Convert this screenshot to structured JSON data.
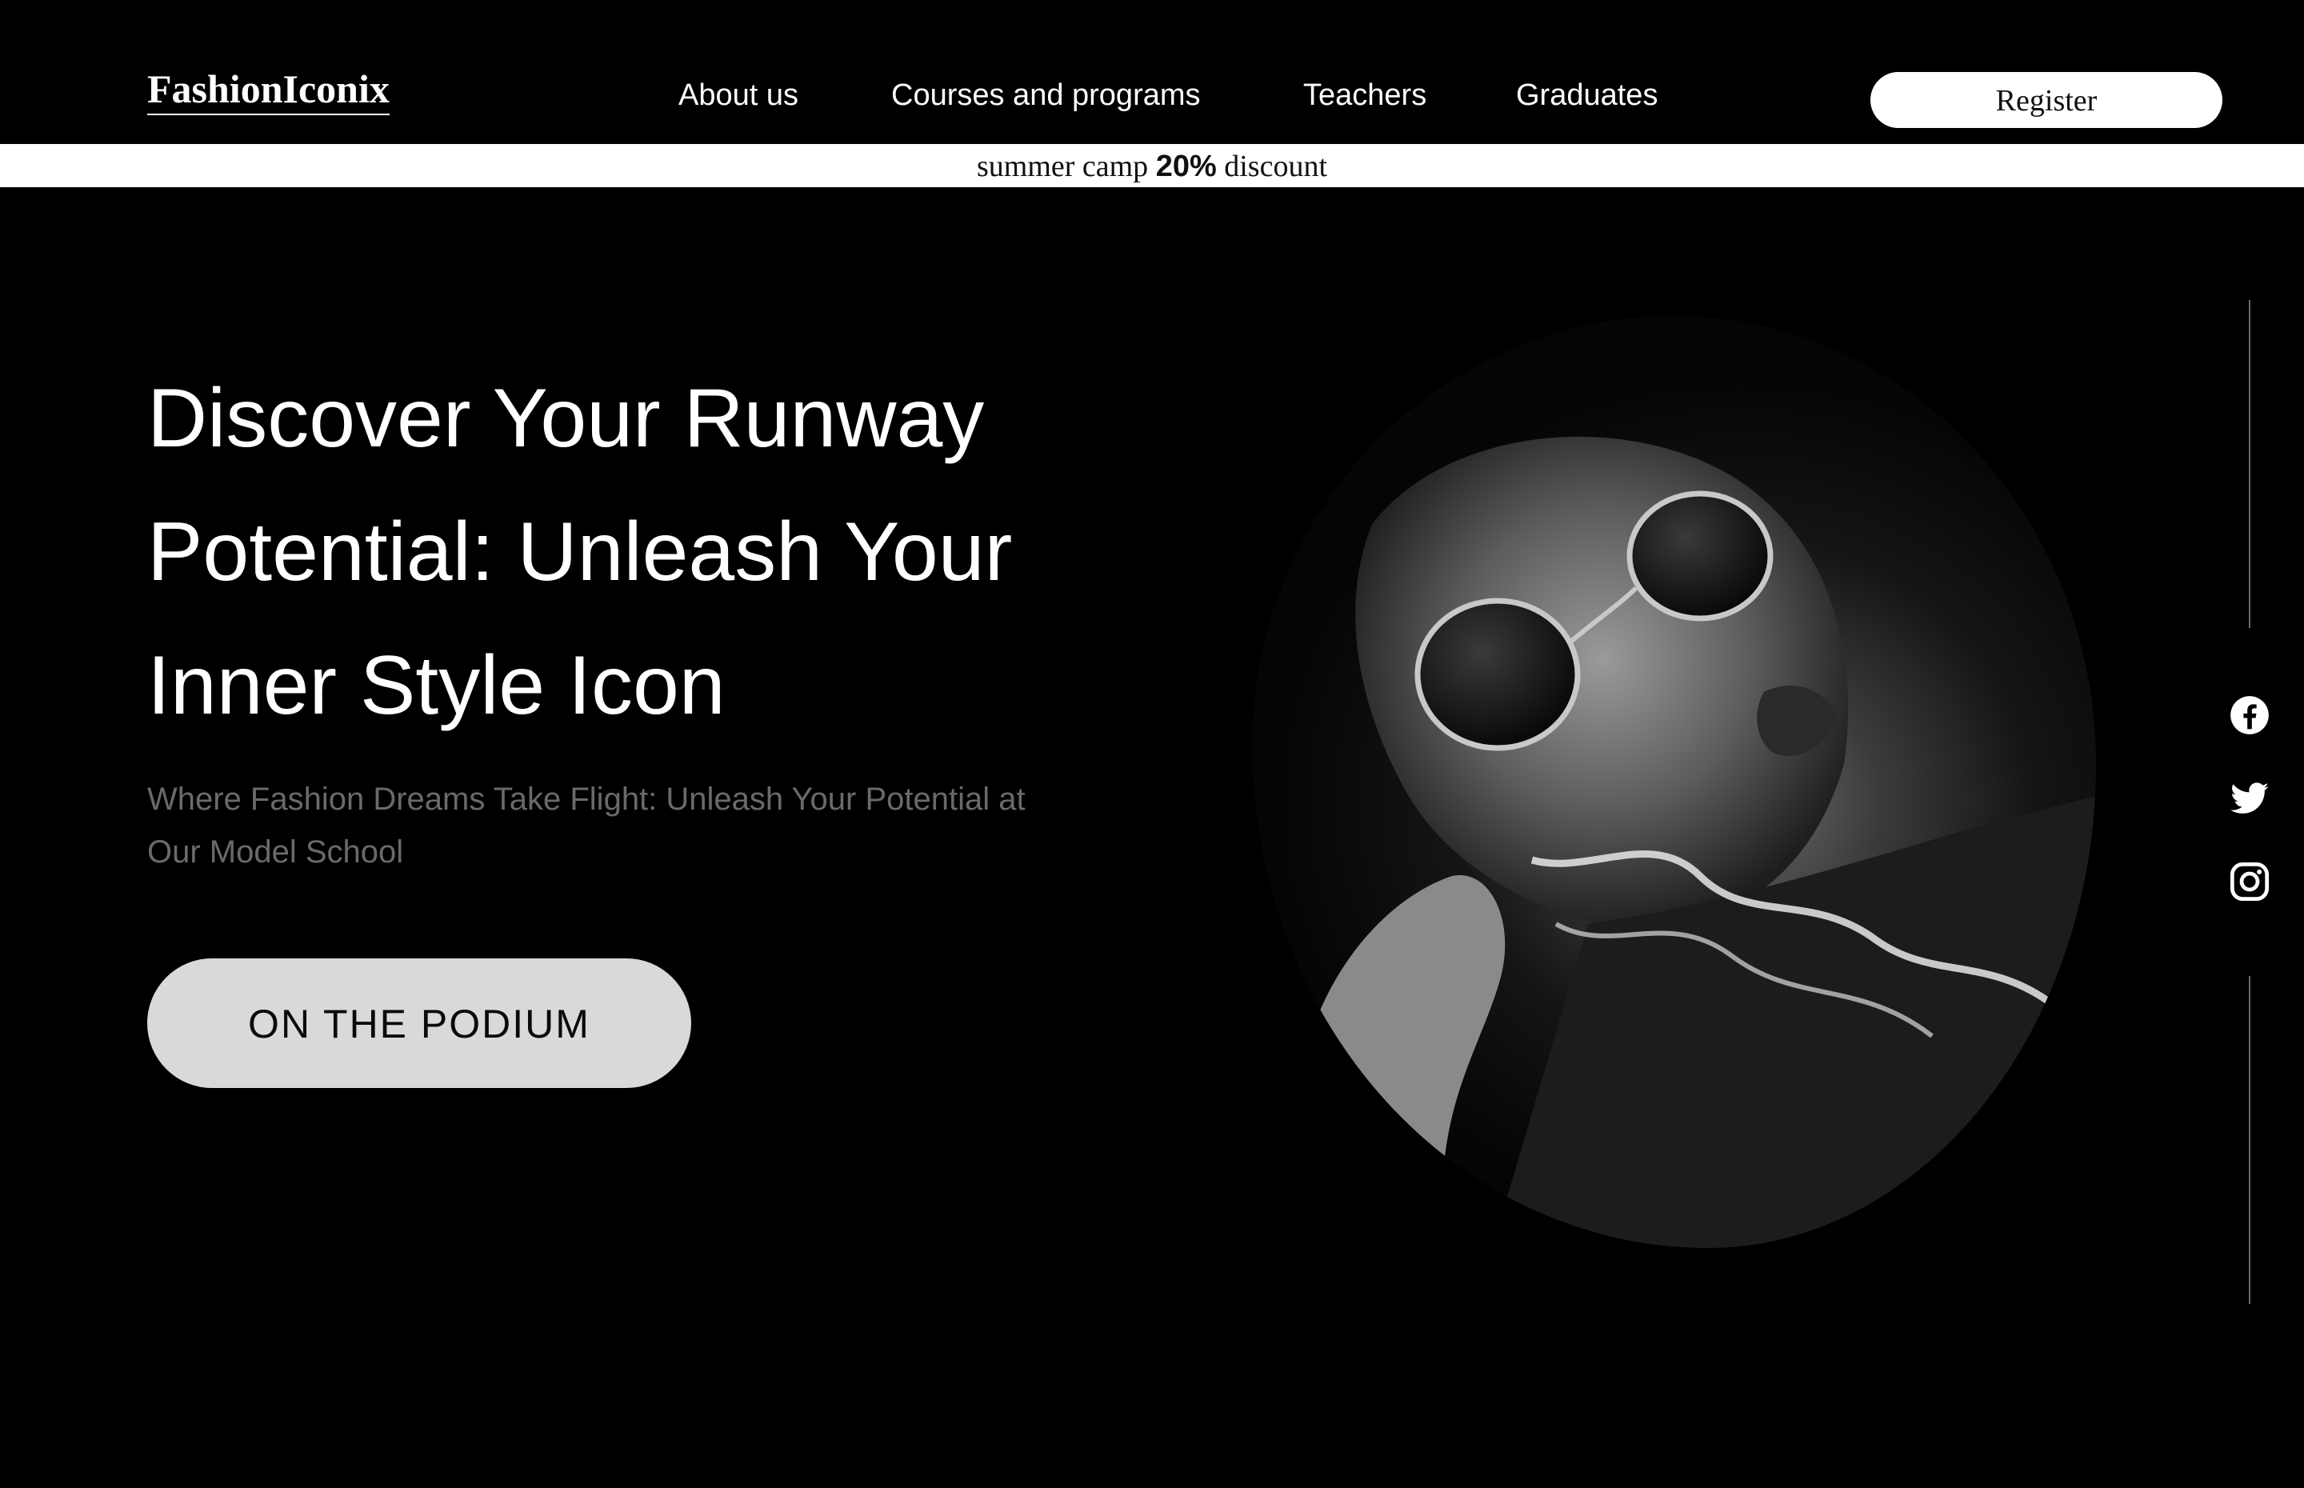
{
  "header": {
    "logo": "FashionIconix",
    "nav": [
      {
        "label": "About us"
      },
      {
        "label": "Courses and programs"
      },
      {
        "label": "Teachers"
      },
      {
        "label": "Graduates"
      }
    ],
    "register_label": "Register"
  },
  "promo": {
    "prefix": "summer camp",
    "highlight": "20%",
    "suffix": "discount"
  },
  "hero": {
    "title_lines": [
      "Discover Your Runway",
      "Potential: Unleash Your",
      "Inner Style Icon"
    ],
    "subtitle": "Where Fashion Dreams Take Flight: Unleash Your Potential at Our Model School",
    "cta_label": "ON THE PODIUM"
  },
  "social": {
    "icons": [
      "facebook-icon",
      "twitter-icon",
      "instagram-icon"
    ]
  },
  "colors": {
    "background": "#000000",
    "text": "#ffffff",
    "muted_text": "#6a6a6a",
    "cta_bg": "#d9d9d9",
    "promo_bg": "#ffffff"
  }
}
